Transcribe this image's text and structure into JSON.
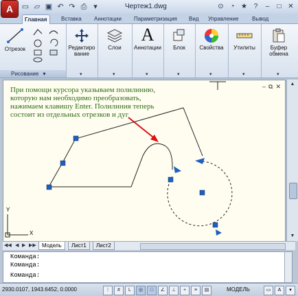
{
  "window": {
    "app_logo": "A",
    "title": "Чертеж1.dwg",
    "search_icon": "binoculars-icon"
  },
  "tabs": [
    "Главная",
    "Вставка",
    "Аннотации",
    "Параметризация",
    "Вид",
    "Управление",
    "Вывод"
  ],
  "ribbon": {
    "line_label": "Отрезок",
    "draw_panel_label": "Рисование",
    "modify_label": "Редактиро вание",
    "layers_label": "Слои",
    "annotations_label": "Аннотации",
    "block_label": "Блок",
    "properties_label": "Свойства",
    "utilities_label": "Утилиты",
    "clipboard_label": "Буфер обмена",
    "annotations_big_letter": "A"
  },
  "annotation_text": "При помощи курсора указываем полилинию, которую нам необходимо преобразовать, нажимаем клавишу Enter. Полилиния теперь состоит из отдельных отрезков  и дуг",
  "ucs": {
    "y": "Y",
    "x": "X"
  },
  "layout_tabs": [
    "Модель",
    "Лист1",
    "Лист2"
  ],
  "command_lines": [
    "Команда:",
    "Команда:",
    "Команда:"
  ],
  "status": {
    "coords": "2930.0107, 1943.6452, 0.0000",
    "model": "МОДЕЛЬ"
  },
  "colors": {
    "grip": "#1f5fbf",
    "annotation_text": "#2c6b16",
    "arrow": "#e01010",
    "canvas_bg": "#fffdf0"
  }
}
